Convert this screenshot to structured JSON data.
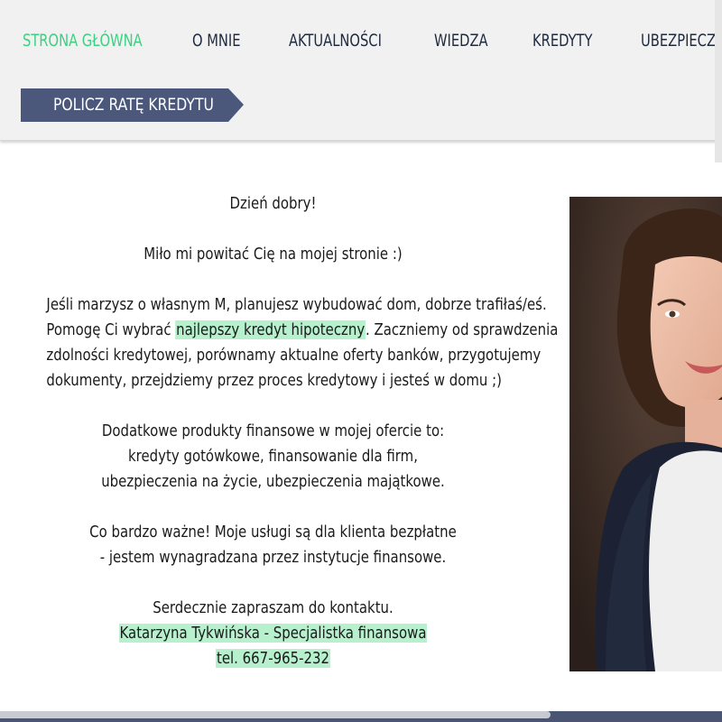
{
  "nav": {
    "items": [
      {
        "label": "STRONA GŁÓWNA",
        "active": true
      },
      {
        "label": "O MNIE",
        "active": false
      },
      {
        "label": "AKTUALNOŚCI",
        "active": false
      },
      {
        "label": "WIEDZA",
        "active": false
      },
      {
        "label": "KREDYTY",
        "active": false
      },
      {
        "label": "UBEZPIECZE",
        "active": false
      }
    ],
    "active_color": "#3ecf82",
    "text_color": "#1f2a3f"
  },
  "cta": {
    "label": "POLICZ RATĘ KREDYTU",
    "color": "#4b587c"
  },
  "content": {
    "greeting": "Dzień dobry!",
    "welcome": "Miło mi powitać Cię na mojej stronie :)",
    "p1_l1": "Jeśli marzysz o własnym M, planujesz wybudować dom, dobrze trafiłaś/eś.",
    "p1_l2_pre": "Pomogę Ci wybrać ",
    "p1_l2_link": "najlepszy kredyt hipoteczny",
    "p1_l2_post": ". Zaczniemy od sprawdzenia",
    "p1_l3": "zdolności kredytowej, porównamy aktualne oferty banków, przygotujemy",
    "p1_l4": "dokumenty, przejdziemy przez proces kredytowy i jesteś w domu ;)",
    "p2_l1": "Dodatkowe produkty finansowe w mojej ofercie to:",
    "p2_l2": "kredyty gotówkowe, finansowanie dla firm,",
    "p2_l3": "ubezpieczenia na życie, ubezpieczenia majątkowe.",
    "p3_l1": "Co bardzo ważne! Moje usługi są dla klienta bezpłatne",
    "p3_l2": "- jestem wynagradzana przez instytucje finansowe.",
    "p4_l1": "Serdecznie zapraszam do kontaktu.",
    "signature": "Katarzyna Tykwińska - Specjalistka finansowa",
    "phone": "tel. 667-965-232"
  },
  "colors": {
    "highlight": "#b6f0cd",
    "bottom_bar": "#4a5473"
  }
}
